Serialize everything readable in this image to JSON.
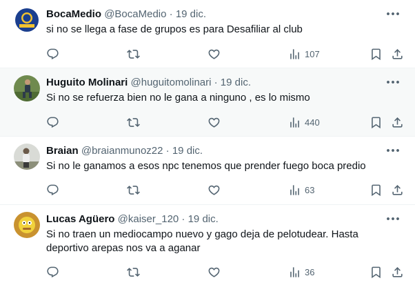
{
  "tweets": [
    {
      "name": "BocaMedio",
      "handle": "@BocaMedio",
      "separator": "·",
      "date": "19 dic.",
      "text": "si no se llega a fase de grupos es para Desafiliar al club",
      "views": "107",
      "avatar_logo_text": "BOCA MEDIO",
      "highlighted": false
    },
    {
      "name": "Huguito Molinari",
      "handle": "@huguitomolinari",
      "separator": "·",
      "date": "19 dic.",
      "text": "Si no se refuerza bien no le gana a ninguno , es lo mismo",
      "views": "440",
      "highlighted": true
    },
    {
      "name": "Braian",
      "handle": "@braianmunoz22",
      "separator": "·",
      "date": "19 dic.",
      "text": "Si no le ganamos a esos npc tenemos que prender fuego boca predio",
      "views": "63",
      "highlighted": false
    },
    {
      "name": "Lucas Agüero",
      "handle": "@kaiser_120",
      "separator": "·",
      "date": "19 dic.",
      "text": "Si no traen un mediocampo nuevo y gago deja de pelotudear. Hasta deportivo arepas nos va a aganar",
      "views": "36",
      "highlighted": false
    }
  ],
  "icons": [
    "more-icon",
    "reply-icon",
    "retweet-icon",
    "like-icon",
    "views-icon",
    "bookmark-icon",
    "share-icon"
  ],
  "colors": {
    "text": "#0f1419",
    "secondary": "#536471",
    "divider": "#eff3f4",
    "highlight_bg": "#f7f9f9"
  }
}
